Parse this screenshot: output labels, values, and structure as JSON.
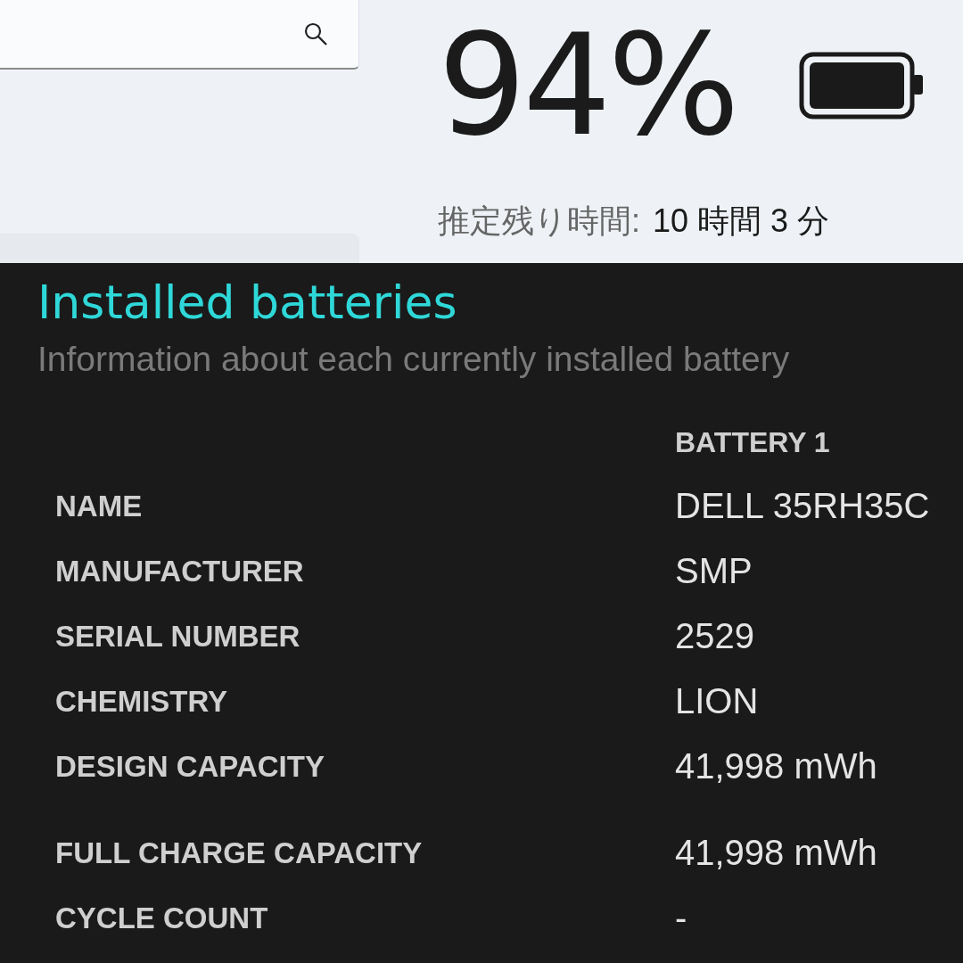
{
  "status": {
    "percent": "94%",
    "estimate_label": "推定残り時間:",
    "estimate_value": "10 時間 3 分"
  },
  "report": {
    "title": "Installed batteries",
    "subtitle": "Information about each currently installed battery",
    "column": "BATTERY 1",
    "rows": [
      {
        "label": "NAME",
        "value": "DELL 35RH35C"
      },
      {
        "label": "MANUFACTURER",
        "value": "SMP"
      },
      {
        "label": "SERIAL NUMBER",
        "value": "2529"
      },
      {
        "label": "CHEMISTRY",
        "value": "LION"
      },
      {
        "label": "DESIGN CAPACITY",
        "value": "41,998 mWh"
      },
      {
        "label": "FULL CHARGE CAPACITY",
        "value": "41,998 mWh"
      },
      {
        "label": "CYCLE COUNT",
        "value": "-"
      }
    ]
  }
}
